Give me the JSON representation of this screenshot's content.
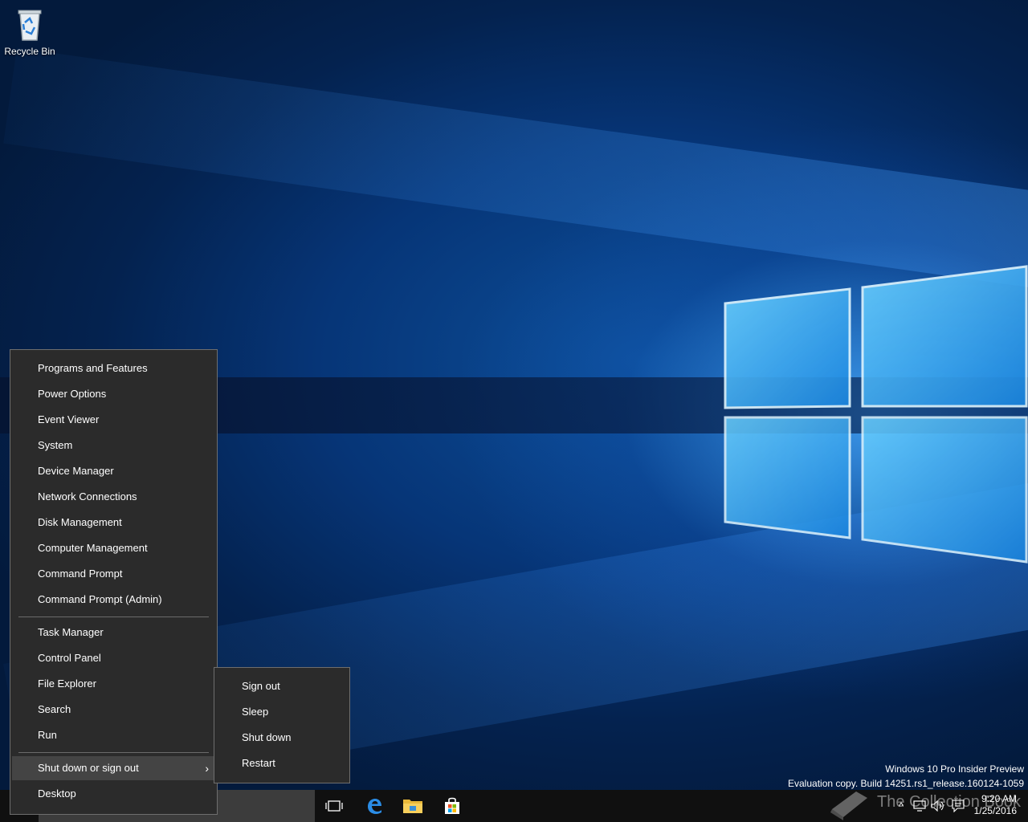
{
  "desktop": {
    "icons": [
      {
        "label": "Recycle Bin",
        "icon": "recycle-bin-icon"
      }
    ],
    "watermark": {
      "line1": "Windows 10 Pro Insider Preview",
      "line2": "Evaluation copy. Build 14251.rs1_release.160124-1059"
    }
  },
  "context_menu": {
    "group1": [
      "Programs and Features",
      "Power Options",
      "Event Viewer",
      "System",
      "Device Manager",
      "Network Connections",
      "Disk Management",
      "Computer Management",
      "Command Prompt",
      "Command Prompt (Admin)"
    ],
    "group2": [
      "Task Manager",
      "Control Panel",
      "File Explorer",
      "Search",
      "Run"
    ],
    "group3": [
      "Shut down or sign out",
      "Desktop"
    ],
    "submenu_arrow": "›"
  },
  "submenu": {
    "items": [
      "Sign out",
      "Sleep",
      "Shut down",
      "Restart"
    ]
  },
  "taskbar": {
    "pinned": [
      "task-view-icon",
      "edge-icon",
      "file-explorer-icon",
      "store-icon"
    ],
    "tray": {
      "chevron": "^"
    },
    "clock": {
      "time": "9:20 AM",
      "date": "1/25/2016"
    }
  },
  "overlay_watermark": {
    "text": "The Collection Book"
  }
}
